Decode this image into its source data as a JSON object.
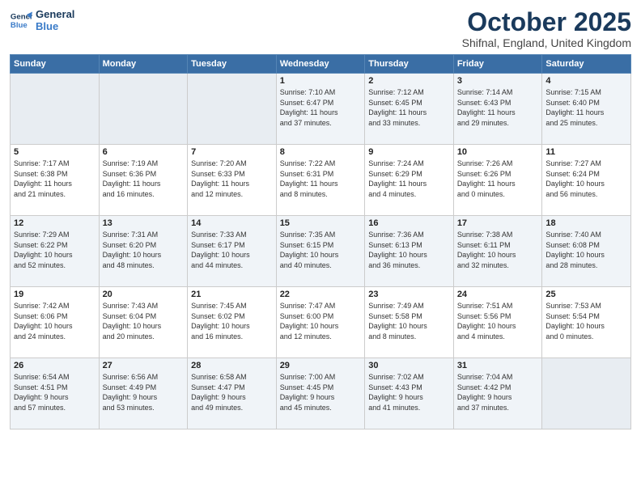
{
  "header": {
    "logo_line1": "General",
    "logo_line2": "Blue",
    "month": "October 2025",
    "location": "Shifnal, England, United Kingdom"
  },
  "weekdays": [
    "Sunday",
    "Monday",
    "Tuesday",
    "Wednesday",
    "Thursday",
    "Friday",
    "Saturday"
  ],
  "weeks": [
    [
      {
        "day": "",
        "info": ""
      },
      {
        "day": "",
        "info": ""
      },
      {
        "day": "",
        "info": ""
      },
      {
        "day": "1",
        "info": "Sunrise: 7:10 AM\nSunset: 6:47 PM\nDaylight: 11 hours\nand 37 minutes."
      },
      {
        "day": "2",
        "info": "Sunrise: 7:12 AM\nSunset: 6:45 PM\nDaylight: 11 hours\nand 33 minutes."
      },
      {
        "day": "3",
        "info": "Sunrise: 7:14 AM\nSunset: 6:43 PM\nDaylight: 11 hours\nand 29 minutes."
      },
      {
        "day": "4",
        "info": "Sunrise: 7:15 AM\nSunset: 6:40 PM\nDaylight: 11 hours\nand 25 minutes."
      }
    ],
    [
      {
        "day": "5",
        "info": "Sunrise: 7:17 AM\nSunset: 6:38 PM\nDaylight: 11 hours\nand 21 minutes."
      },
      {
        "day": "6",
        "info": "Sunrise: 7:19 AM\nSunset: 6:36 PM\nDaylight: 11 hours\nand 16 minutes."
      },
      {
        "day": "7",
        "info": "Sunrise: 7:20 AM\nSunset: 6:33 PM\nDaylight: 11 hours\nand 12 minutes."
      },
      {
        "day": "8",
        "info": "Sunrise: 7:22 AM\nSunset: 6:31 PM\nDaylight: 11 hours\nand 8 minutes."
      },
      {
        "day": "9",
        "info": "Sunrise: 7:24 AM\nSunset: 6:29 PM\nDaylight: 11 hours\nand 4 minutes."
      },
      {
        "day": "10",
        "info": "Sunrise: 7:26 AM\nSunset: 6:26 PM\nDaylight: 11 hours\nand 0 minutes."
      },
      {
        "day": "11",
        "info": "Sunrise: 7:27 AM\nSunset: 6:24 PM\nDaylight: 10 hours\nand 56 minutes."
      }
    ],
    [
      {
        "day": "12",
        "info": "Sunrise: 7:29 AM\nSunset: 6:22 PM\nDaylight: 10 hours\nand 52 minutes."
      },
      {
        "day": "13",
        "info": "Sunrise: 7:31 AM\nSunset: 6:20 PM\nDaylight: 10 hours\nand 48 minutes."
      },
      {
        "day": "14",
        "info": "Sunrise: 7:33 AM\nSunset: 6:17 PM\nDaylight: 10 hours\nand 44 minutes."
      },
      {
        "day": "15",
        "info": "Sunrise: 7:35 AM\nSunset: 6:15 PM\nDaylight: 10 hours\nand 40 minutes."
      },
      {
        "day": "16",
        "info": "Sunrise: 7:36 AM\nSunset: 6:13 PM\nDaylight: 10 hours\nand 36 minutes."
      },
      {
        "day": "17",
        "info": "Sunrise: 7:38 AM\nSunset: 6:11 PM\nDaylight: 10 hours\nand 32 minutes."
      },
      {
        "day": "18",
        "info": "Sunrise: 7:40 AM\nSunset: 6:08 PM\nDaylight: 10 hours\nand 28 minutes."
      }
    ],
    [
      {
        "day": "19",
        "info": "Sunrise: 7:42 AM\nSunset: 6:06 PM\nDaylight: 10 hours\nand 24 minutes."
      },
      {
        "day": "20",
        "info": "Sunrise: 7:43 AM\nSunset: 6:04 PM\nDaylight: 10 hours\nand 20 minutes."
      },
      {
        "day": "21",
        "info": "Sunrise: 7:45 AM\nSunset: 6:02 PM\nDaylight: 10 hours\nand 16 minutes."
      },
      {
        "day": "22",
        "info": "Sunrise: 7:47 AM\nSunset: 6:00 PM\nDaylight: 10 hours\nand 12 minutes."
      },
      {
        "day": "23",
        "info": "Sunrise: 7:49 AM\nSunset: 5:58 PM\nDaylight: 10 hours\nand 8 minutes."
      },
      {
        "day": "24",
        "info": "Sunrise: 7:51 AM\nSunset: 5:56 PM\nDaylight: 10 hours\nand 4 minutes."
      },
      {
        "day": "25",
        "info": "Sunrise: 7:53 AM\nSunset: 5:54 PM\nDaylight: 10 hours\nand 0 minutes."
      }
    ],
    [
      {
        "day": "26",
        "info": "Sunrise: 6:54 AM\nSunset: 4:51 PM\nDaylight: 9 hours\nand 57 minutes."
      },
      {
        "day": "27",
        "info": "Sunrise: 6:56 AM\nSunset: 4:49 PM\nDaylight: 9 hours\nand 53 minutes."
      },
      {
        "day": "28",
        "info": "Sunrise: 6:58 AM\nSunset: 4:47 PM\nDaylight: 9 hours\nand 49 minutes."
      },
      {
        "day": "29",
        "info": "Sunrise: 7:00 AM\nSunset: 4:45 PM\nDaylight: 9 hours\nand 45 minutes."
      },
      {
        "day": "30",
        "info": "Sunrise: 7:02 AM\nSunset: 4:43 PM\nDaylight: 9 hours\nand 41 minutes."
      },
      {
        "day": "31",
        "info": "Sunrise: 7:04 AM\nSunset: 4:42 PM\nDaylight: 9 hours\nand 37 minutes."
      },
      {
        "day": "",
        "info": ""
      }
    ]
  ]
}
